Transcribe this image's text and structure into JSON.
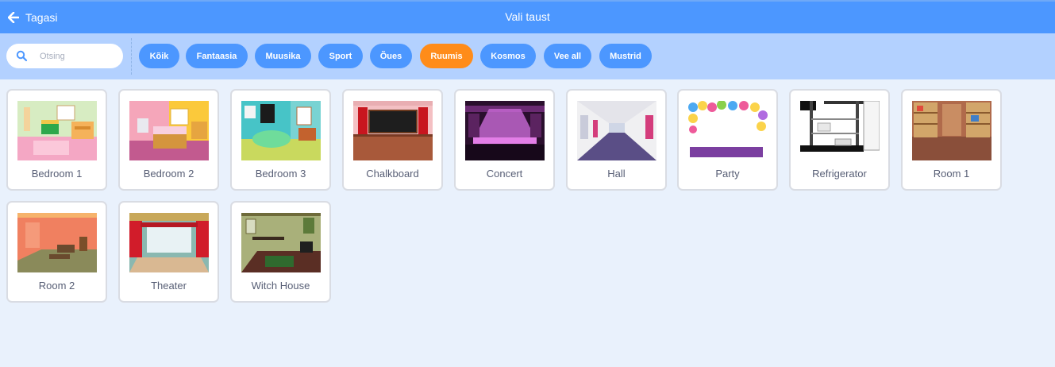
{
  "header": {
    "back_label": "Tagasi",
    "title": "Vali taust",
    "back_icon": "arrow-left-icon"
  },
  "search": {
    "placeholder": "Otsing",
    "value": "",
    "icon": "search-icon"
  },
  "tags": [
    {
      "label": "Kõik",
      "active": false
    },
    {
      "label": "Fantaasia",
      "active": false
    },
    {
      "label": "Muusika",
      "active": false
    },
    {
      "label": "Sport",
      "active": false
    },
    {
      "label": "Õues",
      "active": false
    },
    {
      "label": "Ruumis",
      "active": true
    },
    {
      "label": "Kosmos",
      "active": false
    },
    {
      "label": "Vee all",
      "active": false
    },
    {
      "label": "Mustrid",
      "active": false
    }
  ],
  "backdrops": [
    {
      "name": "Bedroom 1"
    },
    {
      "name": "Bedroom 2"
    },
    {
      "name": "Bedroom 3"
    },
    {
      "name": "Chalkboard"
    },
    {
      "name": "Concert"
    },
    {
      "name": "Hall"
    },
    {
      "name": "Party"
    },
    {
      "name": "Refrigerator"
    },
    {
      "name": "Room 1"
    },
    {
      "name": "Room 2"
    },
    {
      "name": "Theater"
    },
    {
      "name": "Witch House"
    }
  ],
  "colors": {
    "header": "#4c97ff",
    "filter_bar": "#b3d1ff",
    "active_tag": "#ff8c1a",
    "tag": "#4c97ff",
    "background": "#e9f1fc"
  }
}
